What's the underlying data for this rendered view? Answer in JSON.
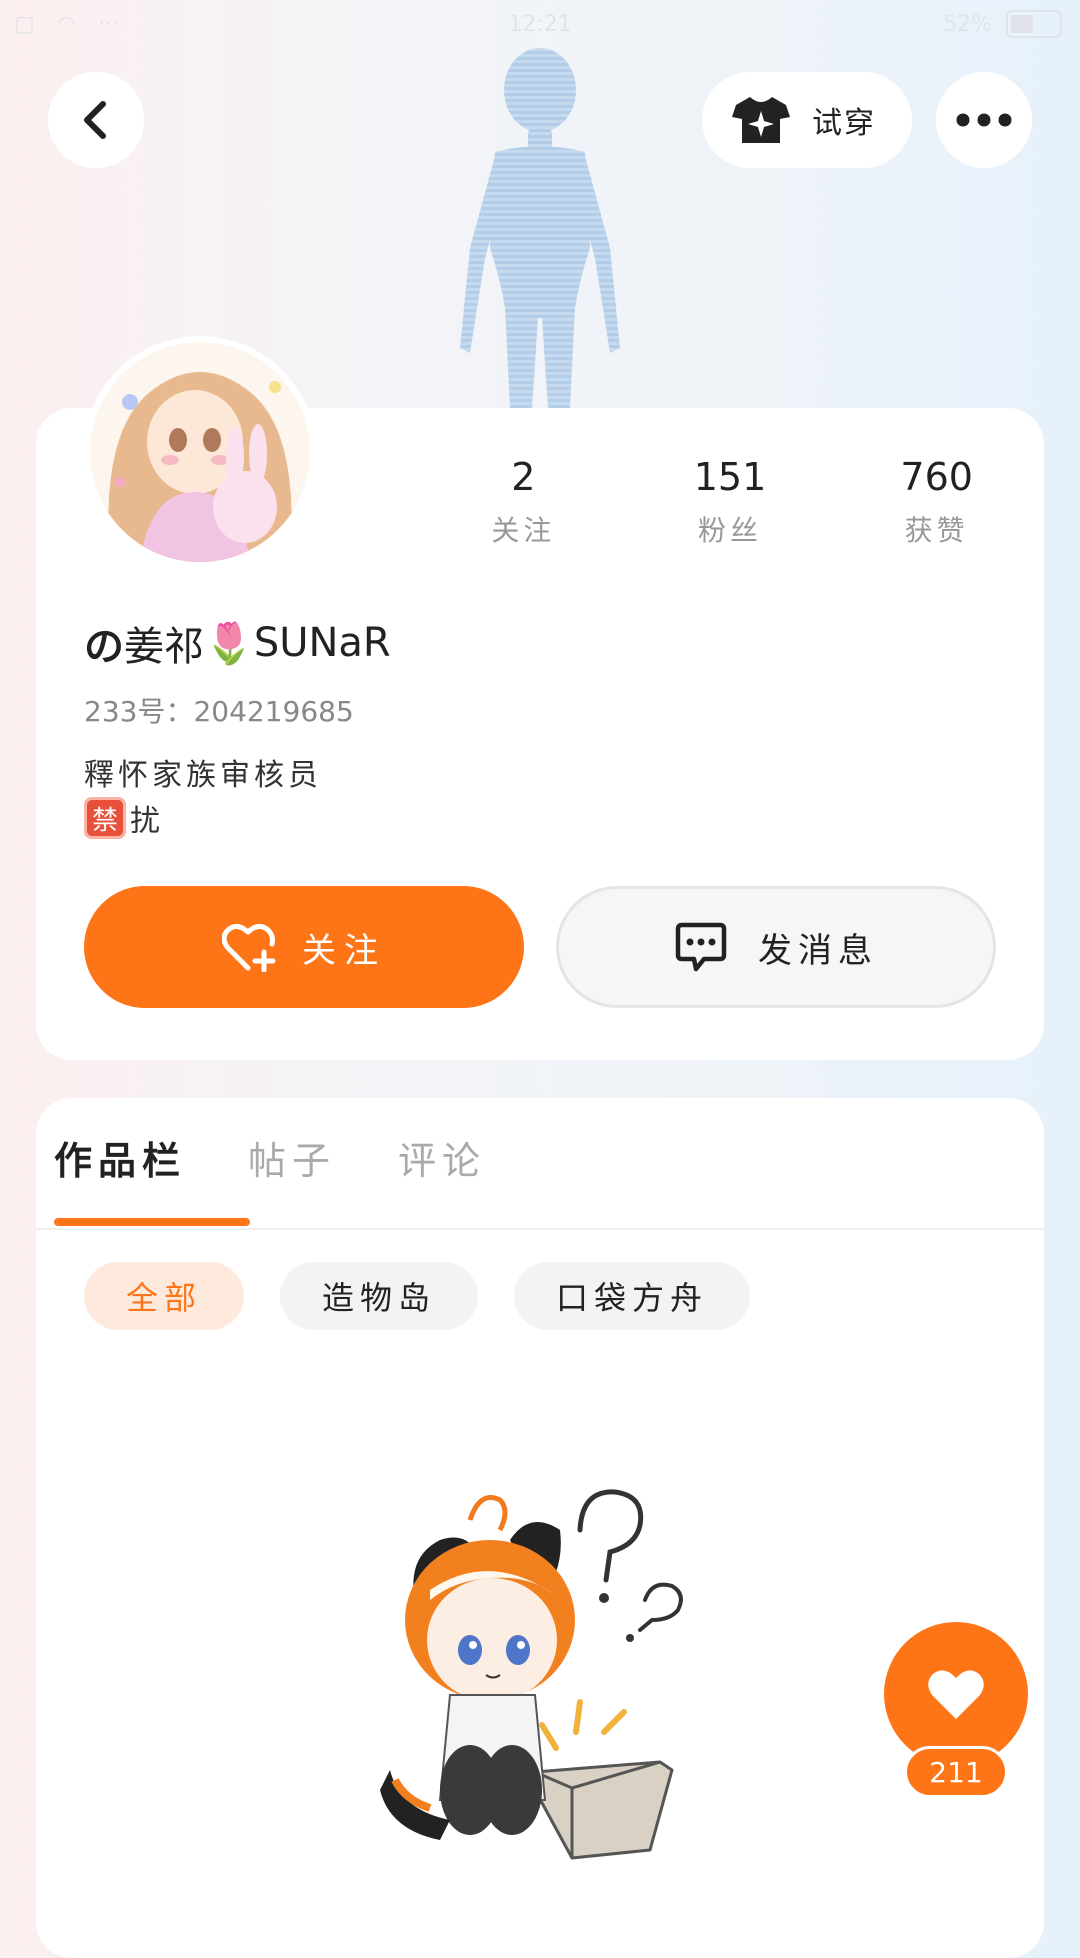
{
  "status_bar": {
    "time": "12:21",
    "battery": "52%"
  },
  "header": {
    "try_on_label": "试穿",
    "icons": {
      "back": "chevron-left-icon",
      "try_on": "tshirt-sparkle-icon",
      "more": "more-dots-icon"
    }
  },
  "profile": {
    "stats": [
      {
        "value": "2",
        "label": "关注"
      },
      {
        "value": "151",
        "label": "粉丝"
      },
      {
        "value": "760",
        "label": "获赞"
      }
    ],
    "name_prefix": "の",
    "name_middle": "姜祁",
    "name_suffix": "SUNaR",
    "name_emoji": "🌷",
    "uid_label": "233号：",
    "uid": "204219685",
    "bio_line1": "釋怀家族审核员",
    "bio_badge": "禁",
    "bio_line2": "扰"
  },
  "actions": {
    "follow_label": "关注",
    "message_label": "发消息",
    "accent": "#fe7518"
  },
  "tabs": [
    {
      "label": "作品栏",
      "active": true
    },
    {
      "label": "帖子",
      "active": false
    },
    {
      "label": "评论",
      "active": false
    }
  ],
  "filters": [
    {
      "label": "全部",
      "active": true
    },
    {
      "label": "造物岛",
      "active": false
    },
    {
      "label": "口袋方舟",
      "active": false
    }
  ],
  "like_fab": {
    "count": "211"
  }
}
